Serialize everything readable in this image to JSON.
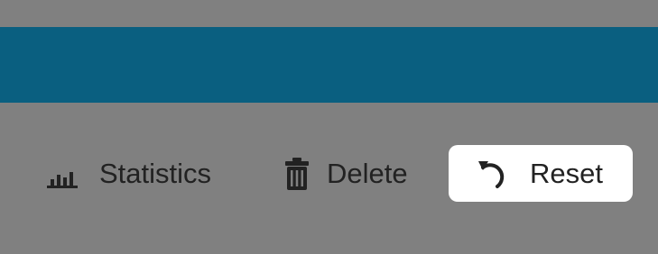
{
  "header": {
    "bar_color": "#0a5f80"
  },
  "actions": {
    "statistics": {
      "label": "Statistics",
      "icon": "bar-chart-icon"
    },
    "delete": {
      "label": "Delete",
      "icon": "trash-icon"
    },
    "reset": {
      "label": "Reset",
      "icon": "undo-icon",
      "selected": true
    }
  },
  "colors": {
    "background": "#808080",
    "text": "#222222",
    "selected_background": "#ffffff"
  }
}
